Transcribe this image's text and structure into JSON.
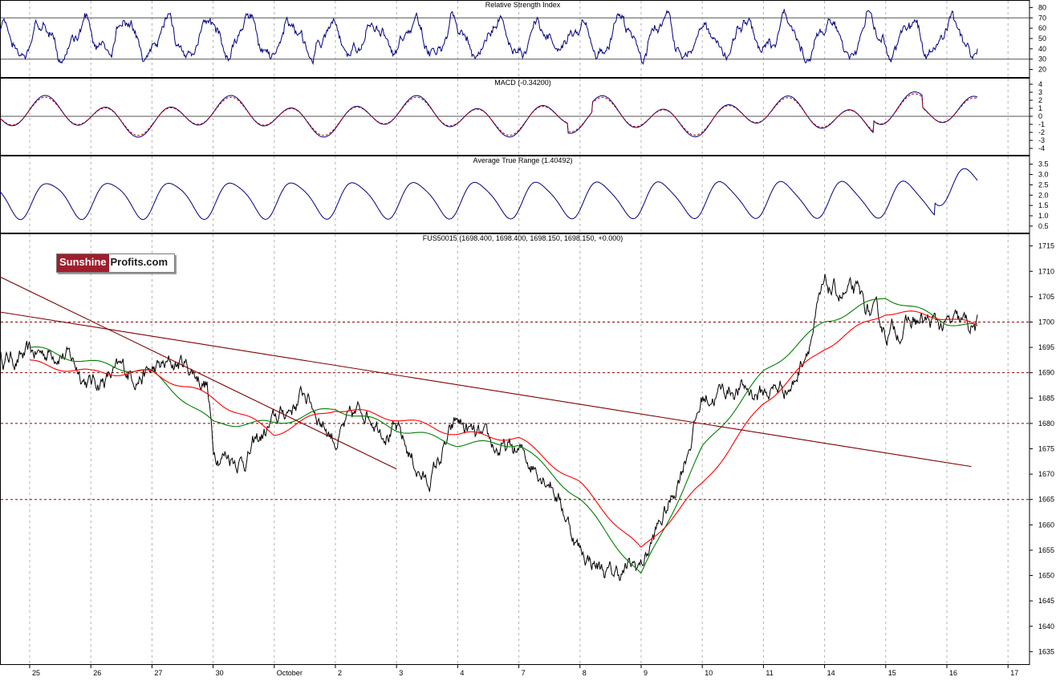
{
  "chart_data": [
    {
      "type": "line",
      "title": "Relative Strength Index",
      "ylim": [
        15,
        85
      ],
      "yticks": [
        20,
        30,
        40,
        50,
        60,
        70,
        80
      ],
      "reference_lines": [
        30,
        70
      ],
      "series": [
        {
          "color": "#00007f"
        }
      ],
      "grid": true
    },
    {
      "type": "line",
      "title": "MACD (-0.34200)",
      "ylim": [
        -4.5,
        4.5
      ],
      "yticks": [
        -4,
        -3,
        -2,
        -1,
        0,
        1,
        2,
        3,
        4
      ],
      "reference_lines": [
        0
      ],
      "series": [
        {
          "color": "#00007f"
        },
        {
          "color": "#c00000",
          "dashed": true
        }
      ],
      "grid": true
    },
    {
      "type": "line",
      "title": "Average True Range (1.40492)",
      "ylim": [
        0.3,
        3.8
      ],
      "yticks": [
        "0.5",
        "1.0",
        "1.5",
        "2.0",
        "2.5",
        "3.0",
        "3.5"
      ],
      "series": [
        {
          "color": "#00007f"
        }
      ],
      "grid": true
    },
    {
      "type": "line",
      "title": "FUS50015 (1698.400, 1698.400, 1698.150, 1698.150, +0.000)",
      "ylim": [
        1633,
        1717
      ],
      "yticks": [
        1635,
        1640,
        1645,
        1650,
        1655,
        1660,
        1665,
        1670,
        1675,
        1680,
        1685,
        1690,
        1695,
        1700,
        1705,
        1710,
        1715
      ],
      "x_categories": [
        "25",
        "26",
        "27",
        "30",
        "October",
        "2",
        "3",
        "4",
        "7",
        "8",
        "9",
        "10",
        "11",
        "14",
        "15",
        "16",
        "17"
      ],
      "horizontal_levels": [
        1665,
        1680,
        1690,
        1700
      ],
      "price_path": {
        "x": [
          0,
          0.5,
          1,
          1.5,
          2,
          2.5,
          2.9,
          3,
          3.5,
          4,
          4.5,
          5,
          5.5,
          6,
          6.5,
          7,
          7.5,
          8,
          8.5,
          9,
          9.5,
          10,
          10.5,
          11,
          11.5,
          12,
          12.5,
          13,
          13.5,
          14,
          14.5,
          15,
          15.5
        ],
        "y": [
          1693,
          1695,
          1688,
          1690,
          1690,
          1692,
          1688,
          1675,
          1673,
          1680,
          1686,
          1677,
          1683,
          1678,
          1668,
          1680,
          1675,
          1674,
          1670,
          1655,
          1650,
          1652,
          1665,
          1685,
          1687,
          1686,
          1688,
          1706,
          1705,
          1698,
          1700,
          1699,
          1699
        ]
      },
      "moving_averages": [
        {
          "color": "#007f00",
          "x": [
            0,
            1,
            2,
            3,
            4,
            5,
            6,
            7,
            8,
            9,
            10,
            11,
            12,
            13,
            14,
            15,
            15.5
          ],
          "y": [
            1695,
            1692,
            1690,
            1680,
            1680,
            1683,
            1679,
            1676,
            1676,
            1665,
            1650,
            1675,
            1690,
            1700,
            1705,
            1700,
            1699
          ]
        },
        {
          "color": "#ff0000",
          "x": [
            0,
            1,
            2,
            3,
            4,
            5,
            6,
            7,
            8,
            9,
            10,
            11,
            12,
            13,
            14,
            15,
            15.5
          ],
          "y": [
            1692,
            1690,
            1690,
            1685,
            1678,
            1683,
            1681,
            1678,
            1677,
            1668,
            1655,
            1668,
            1684,
            1695,
            1702,
            1701,
            1699
          ]
        }
      ],
      "trendlines": [
        {
          "color": "#7f0000",
          "x": [
            -0.5,
            15.4
          ],
          "y": [
            1702,
            1671.5
          ]
        },
        {
          "color": "#7f0000",
          "x": [
            -0.5,
            6
          ],
          "y": [
            1709,
            1671
          ]
        }
      ],
      "grid": true
    }
  ],
  "logo": {
    "part1": "Sunshine",
    "part2": "Profits.com"
  }
}
